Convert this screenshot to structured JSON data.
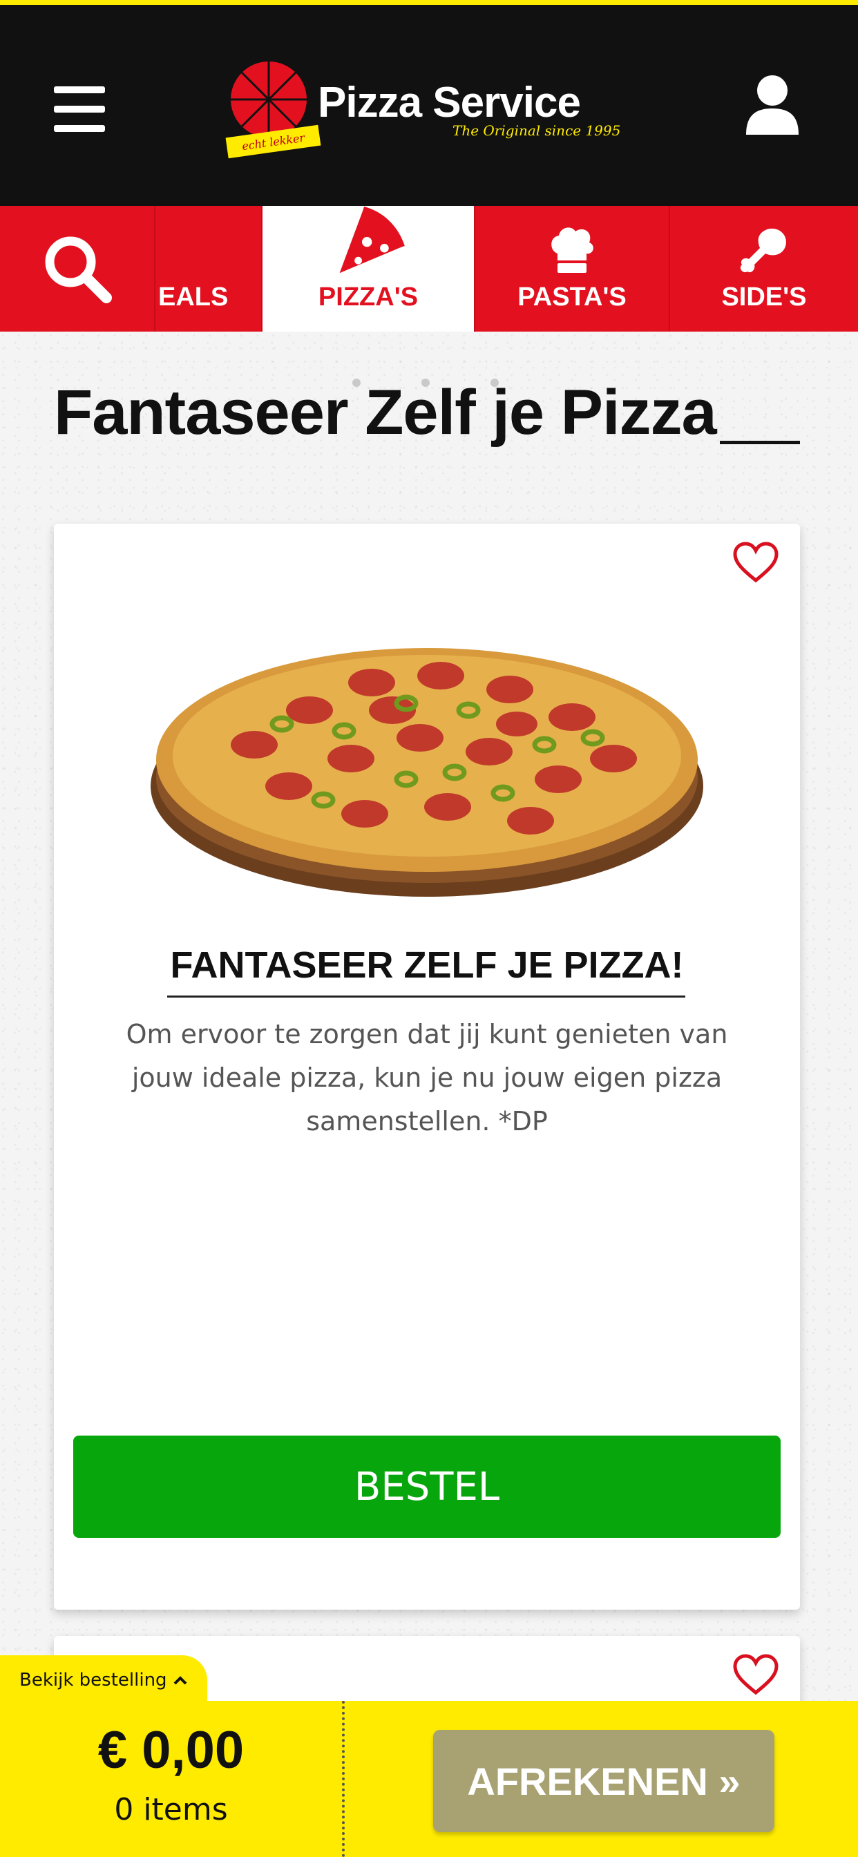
{
  "colors": {
    "brand_red": "#e3101f",
    "header_black": "#111111",
    "accent_yellow": "#ffeb00",
    "order_green": "#07a60d",
    "checkout_disabled": "#a8a272"
  },
  "header": {
    "menu_icon": "hamburger-menu-icon",
    "logo_title": "Pizza Service",
    "logo_subtitle": "The Original since 1995",
    "logo_tag": "echt lekker",
    "user_icon": "user-icon"
  },
  "categories": [
    {
      "label": "",
      "icon": "search-icon"
    },
    {
      "label": "EALS",
      "icon": ""
    },
    {
      "label": "PIZZA'S",
      "icon": "pizza-slice-icon",
      "active": true
    },
    {
      "label": "PASTA'S",
      "icon": "chef-hat-icon"
    },
    {
      "label": "SIDE'S",
      "icon": "chicken-leg-icon"
    }
  ],
  "page": {
    "title": "Fantaseer Zelf je Pizza"
  },
  "product": {
    "name": "FANTASEER ZELF JE PIZZA!",
    "description": "Om ervoor te zorgen dat jij kunt genieten van jouw ideale pizza, kun je nu jouw eigen pizza samenstellen. *DP",
    "order_label": "BESTEL",
    "favorite_icon": "heart-icon"
  },
  "cart": {
    "view_order_label": "Bekijk bestelling",
    "total": "€ 0,00",
    "items": "0 items",
    "checkout_label": "AFREKENEN »"
  }
}
